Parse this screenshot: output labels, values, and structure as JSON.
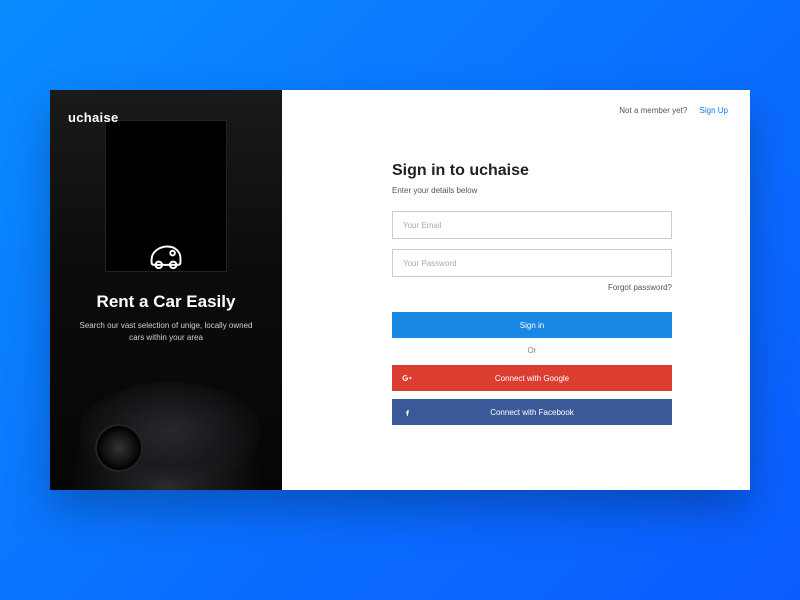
{
  "brand": "uchaise",
  "hero": {
    "title": "Rent a Car Easily",
    "subtitle": "Search our vast selection of unige, locally owned cars within your area"
  },
  "topbar": {
    "prompt": "Not a member yet?",
    "signup_label": "Sign Up"
  },
  "form": {
    "title": "Sign in to uchaise",
    "subtitle": "Enter your details below",
    "email_placeholder": "Your Email",
    "email_value": "",
    "password_placeholder": "Your Password",
    "password_value": "",
    "forgot_label": "Forgot password?",
    "signin_label": "Sign in",
    "or_label": "Or",
    "google_label": "Connect with Google",
    "facebook_label": "Connect with Facebook"
  },
  "colors": {
    "primary": "#1b87e5",
    "google": "#db3e30",
    "facebook": "#3b5998",
    "bg_gradient_start": "#0a8cff",
    "bg_gradient_end": "#0a5cff"
  }
}
